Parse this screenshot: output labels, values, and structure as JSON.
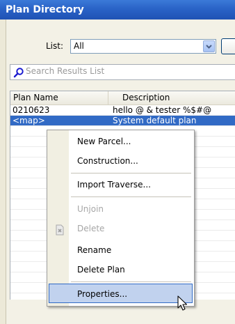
{
  "window": {
    "title": "Plan Directory"
  },
  "filter": {
    "label": "List:",
    "selected": "All"
  },
  "search": {
    "placeholder": "Search Results List"
  },
  "table": {
    "columns": [
      "Plan Name",
      "Description"
    ],
    "rows": [
      {
        "name": "0210623",
        "description": "hello @ & tester %$#@"
      },
      {
        "name": "<map>",
        "description": "System default plan"
      }
    ]
  },
  "context_menu": {
    "items": [
      {
        "label": "New Parcel...",
        "enabled": true
      },
      {
        "label": "Construction...",
        "enabled": true
      },
      {
        "label": "Import Traverse...",
        "enabled": true
      },
      {
        "label": "Unjoin",
        "enabled": false
      },
      {
        "label": "Delete",
        "enabled": false
      },
      {
        "label": "Rename",
        "enabled": true
      },
      {
        "label": "Delete Plan",
        "enabled": true
      },
      {
        "label": "Properties...",
        "enabled": true
      }
    ]
  },
  "icons": {
    "search": "search-icon",
    "combo": "chevron-down-icon",
    "delete": "delete-icon",
    "cursor": "mouse-pointer-icon"
  },
  "colors": {
    "title_bar": "#2a63c7",
    "selection": "#316ac5",
    "menu_hover": "#c1d2ee",
    "disabled_text": "#a6a6a6"
  }
}
